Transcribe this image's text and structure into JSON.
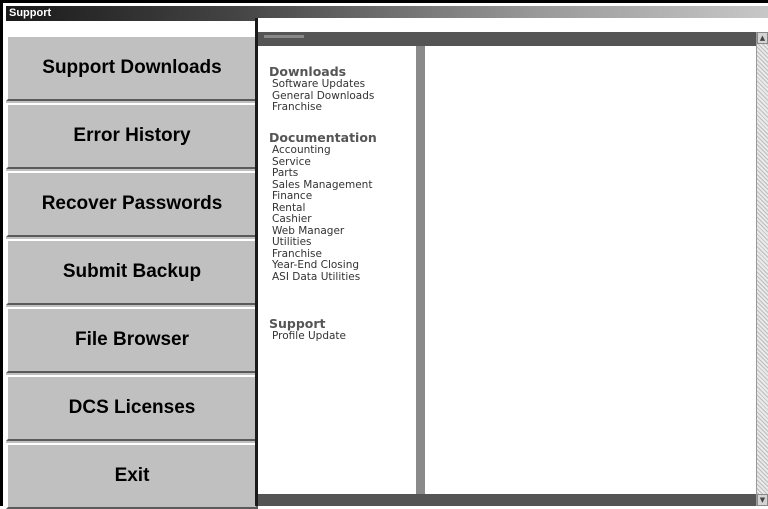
{
  "window": {
    "title": "Support"
  },
  "nav": {
    "buttons": [
      {
        "label": "Support Downloads"
      },
      {
        "label": "Error History"
      },
      {
        "label": "Recover Passwords"
      },
      {
        "label": "Submit Backup"
      },
      {
        "label": "File Browser"
      },
      {
        "label": "DCS Licenses"
      },
      {
        "label": "Exit"
      }
    ]
  },
  "docs": {
    "downloads": {
      "title": "Downloads",
      "items": [
        "Software Updates",
        "General Downloads",
        "Franchise"
      ]
    },
    "documentation": {
      "title": "Documentation",
      "items": [
        "Accounting",
        "Service",
        "Parts",
        "Sales Management",
        "Finance",
        "Rental",
        "Cashier",
        "Web Manager",
        "Utilities",
        "Franchise",
        "Year-End Closing",
        "ASI Data Utilities"
      ]
    },
    "support": {
      "title": "Support",
      "items": [
        "Profile Update"
      ]
    }
  },
  "icons": {
    "scroll_up": "up-arrow-icon",
    "scroll_down": "down-arrow-icon"
  }
}
